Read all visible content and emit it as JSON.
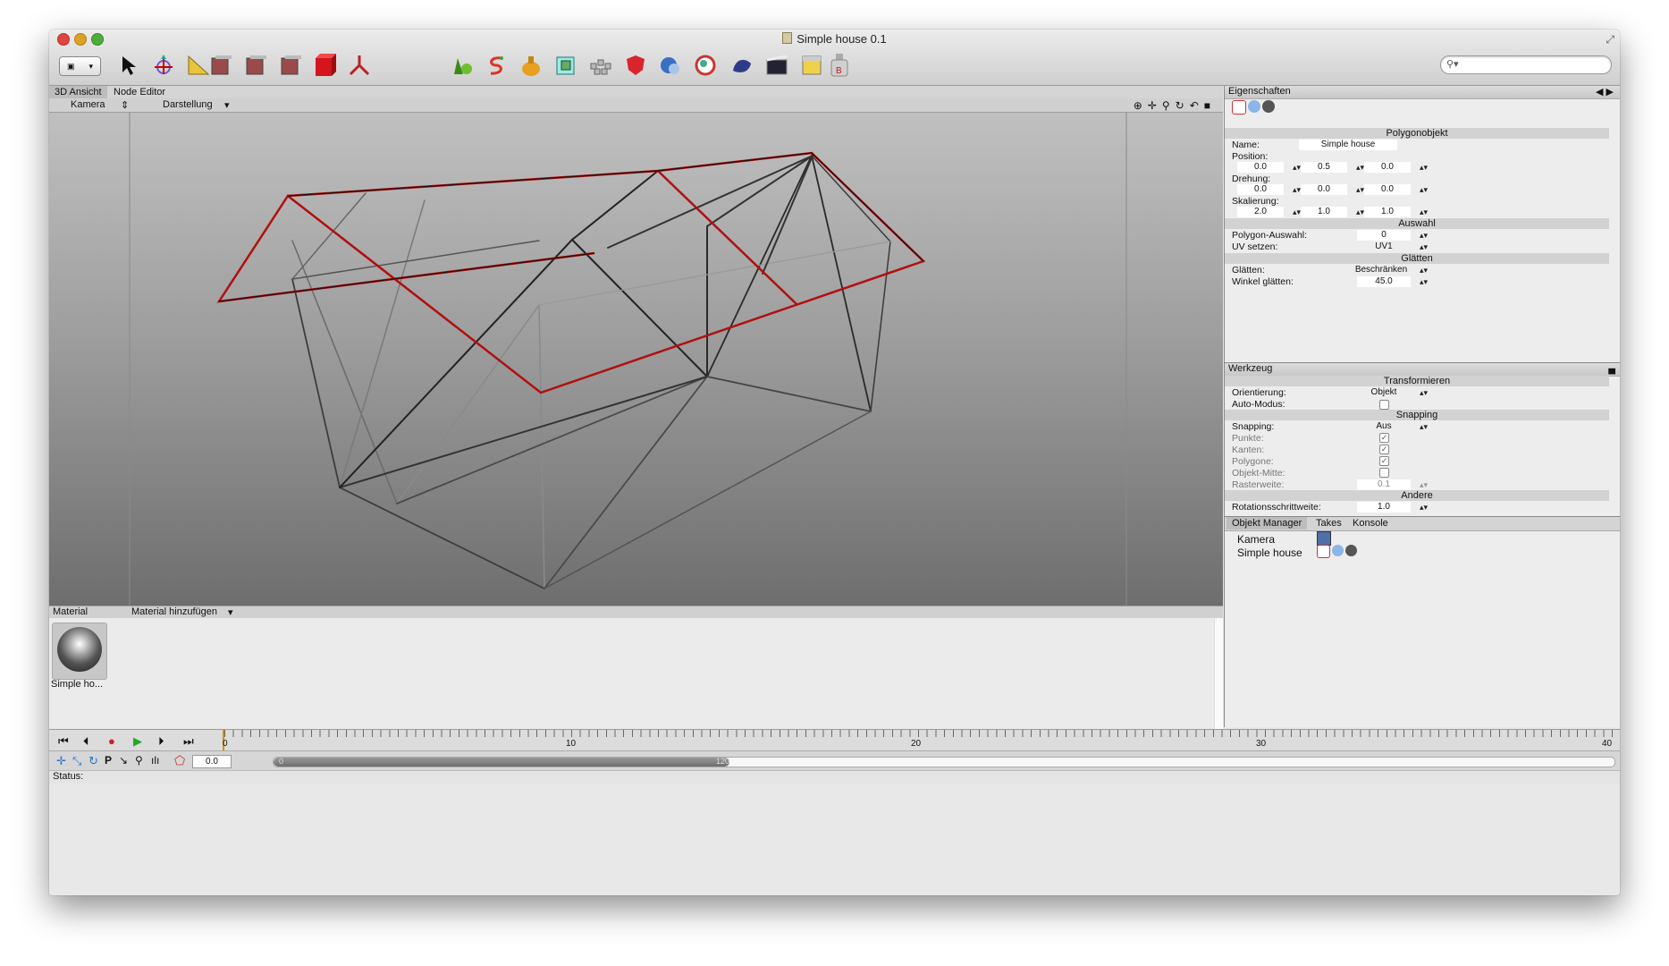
{
  "window": {
    "title": "Simple house 0.1"
  },
  "viewport_tabs": [
    "3D Ansicht",
    "Node Editor"
  ],
  "viewport_menu": {
    "camera": "Kamera",
    "display": "Darstellung"
  },
  "material": {
    "header": "Material",
    "add": "Material hinzufügen",
    "item_label": "Simple ho..."
  },
  "properties": {
    "title": "Eigenschaften",
    "section_object": "Polygonobjekt",
    "name_label": "Name:",
    "name_value": "Simple house",
    "position_label": "Position:",
    "position": [
      "0.0",
      "0.5",
      "0.0"
    ],
    "rotation_label": "Drehung:",
    "rotation": [
      "0.0",
      "0.0",
      "0.0"
    ],
    "scale_label": "Skalierung:",
    "scale": [
      "2.0",
      "1.0",
      "1.0"
    ],
    "section_selection": "Auswahl",
    "poly_sel_label": "Polygon-Auswahl:",
    "poly_sel_value": "0",
    "uv_label": "UV setzen:",
    "uv_value": "UV1",
    "section_smooth": "Glätten",
    "smooth_label": "Glätten:",
    "smooth_value": "Beschränken",
    "angle_label": "Winkel glätten:",
    "angle_value": "45.0"
  },
  "tool": {
    "title": "Werkzeug",
    "section_transform": "Transformieren",
    "orient_label": "Orientierung:",
    "orient_value": "Objekt",
    "auto_label": "Auto-Modus:",
    "section_snapping": "Snapping",
    "snap_label": "Snapping:",
    "snap_value": "Aus",
    "points_label": "Punkte:",
    "edges_label": "Kanten:",
    "polys_label": "Polygone:",
    "center_label": "Objekt-Mitte:",
    "grid_label": "Rasterweite:",
    "grid_value": "0.1",
    "section_other": "Andere",
    "rotstep_label": "Rotationsschrittweite:",
    "rotstep_value": "1.0"
  },
  "object_manager": {
    "tabs": [
      "Objekt Manager",
      "Takes",
      "Konsole"
    ],
    "objects": [
      "Kamera",
      "Simple house"
    ]
  },
  "timeline": {
    "labels": [
      "0",
      "10",
      "20",
      "30",
      "40"
    ],
    "frame_value": "0.0",
    "range_end": "120",
    "range_start": "0"
  },
  "status": {
    "label": "Status:"
  },
  "colors": {
    "accent_red": "#b01010",
    "viewport_top": "#c0c0c0",
    "viewport_bottom": "#6e6e6e"
  }
}
